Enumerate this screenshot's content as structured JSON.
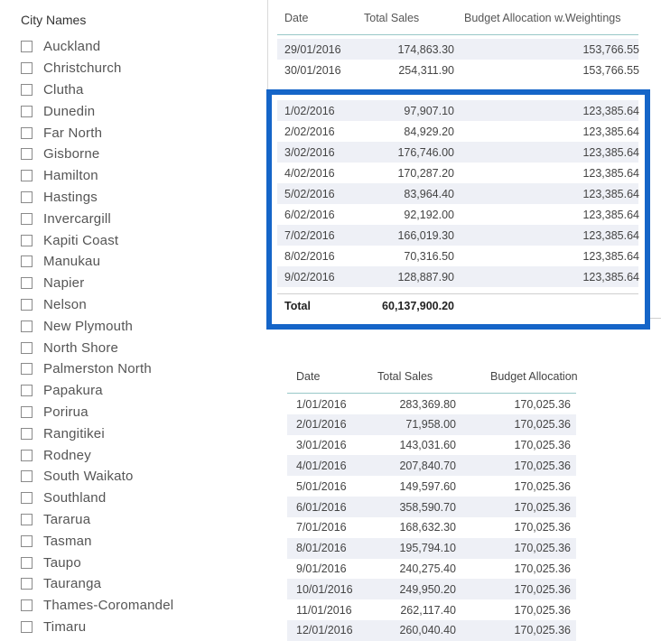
{
  "slicer": {
    "title": "City Names",
    "items": [
      "Auckland",
      "Christchurch",
      "Clutha",
      "Dunedin",
      "Far North",
      "Gisborne",
      "Hamilton",
      "Hastings",
      "Invercargill",
      "Kapiti Coast",
      "Manukau",
      "Napier",
      "Nelson",
      "New Plymouth",
      "North Shore",
      "Palmerston North",
      "Papakura",
      "Porirua",
      "Rangitikei",
      "Rodney",
      "South Waikato",
      "Southland",
      "Tararua",
      "Tasman",
      "Taupo",
      "Tauranga",
      "Thames-Coromandel",
      "Timaru"
    ]
  },
  "top_table": {
    "headers": [
      "Date",
      "Total Sales",
      "Budget Allocation w.Weightings"
    ],
    "rows": [
      [
        "29/01/2016",
        "174,863.30",
        "153,766.55"
      ],
      [
        "30/01/2016",
        "254,311.90",
        "153,766.55"
      ],
      [
        "1/02/2016",
        "97,907.10",
        "123,385.64"
      ],
      [
        "2/02/2016",
        "84,929.20",
        "123,385.64"
      ],
      [
        "3/02/2016",
        "176,746.00",
        "123,385.64"
      ],
      [
        "4/02/2016",
        "170,287.20",
        "123,385.64"
      ],
      [
        "5/02/2016",
        "83,964.40",
        "123,385.64"
      ],
      [
        "6/02/2016",
        "92,192.00",
        "123,385.64"
      ],
      [
        "7/02/2016",
        "166,019.30",
        "123,385.64"
      ],
      [
        "8/02/2016",
        "70,316.50",
        "123,385.64"
      ],
      [
        "9/02/2016",
        "128,887.90",
        "123,385.64"
      ]
    ],
    "total": {
      "label": "Total",
      "sales": "60,137,900.20"
    }
  },
  "bottom_table": {
    "headers": [
      "Date",
      "Total Sales",
      "Budget Allocation"
    ],
    "rows": [
      [
        "1/01/2016",
        "283,369.80",
        "170,025.36"
      ],
      [
        "2/01/2016",
        "71,958.00",
        "170,025.36"
      ],
      [
        "3/01/2016",
        "143,031.60",
        "170,025.36"
      ],
      [
        "4/01/2016",
        "207,840.70",
        "170,025.36"
      ],
      [
        "5/01/2016",
        "149,597.60",
        "170,025.36"
      ],
      [
        "6/01/2016",
        "358,590.70",
        "170,025.36"
      ],
      [
        "7/01/2016",
        "168,632.30",
        "170,025.36"
      ],
      [
        "8/01/2016",
        "195,794.10",
        "170,025.36"
      ],
      [
        "9/01/2016",
        "240,275.40",
        "170,025.36"
      ],
      [
        "10/01/2016",
        "249,950.20",
        "170,025.36"
      ],
      [
        "11/01/2016",
        "262,117.40",
        "170,025.36"
      ],
      [
        "12/01/2016",
        "260,040.40",
        "170,025.36"
      ]
    ]
  },
  "colors": {
    "highlight": "#1565c8",
    "row_shade": "#eef0f6",
    "header_rule": "#98c8c8"
  }
}
